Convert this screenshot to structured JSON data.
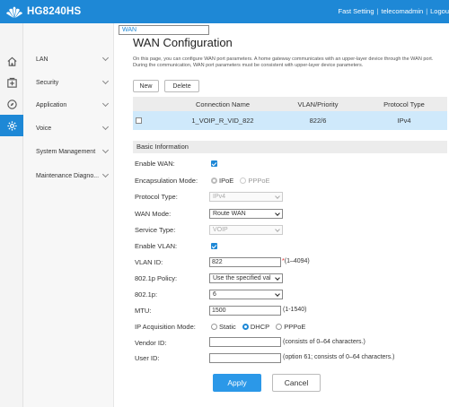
{
  "header": {
    "brand": "HG8240HS",
    "links": [
      "Fast Setting",
      "telecomadmin",
      "Logou"
    ],
    "background_color": "#1e88d6"
  },
  "icon_bar": [
    "home-icon",
    "plus-box-icon",
    "compass-icon",
    "gear-icon"
  ],
  "menu": {
    "items": [
      {
        "label": "WAN",
        "selected": true,
        "expandable": false
      },
      {
        "label": "LAN",
        "selected": false,
        "expandable": true
      },
      {
        "label": "Security",
        "selected": false,
        "expandable": true
      },
      {
        "label": "Application",
        "selected": false,
        "expandable": true
      },
      {
        "label": "Voice",
        "selected": false,
        "expandable": true
      },
      {
        "label": "System Management",
        "selected": false,
        "expandable": true
      },
      {
        "label": "Maintenance Diagno...",
        "selected": false,
        "expandable": true
      }
    ]
  },
  "page": {
    "title": "WAN Configuration",
    "description": "On this page, you can configure WAN port parameters. A home gateway communicates with an upper-layer device through the WAN port. During the communication, WAN port parameters must be consistent with upper-layer device parameters."
  },
  "toolbar": {
    "new_label": "New",
    "delete_label": "Delete"
  },
  "table": {
    "columns": [
      "Connection Name",
      "VLAN/Priority",
      "Protocol Type"
    ],
    "rows": [
      {
        "connection_name": "1_VOIP_R_VID_822",
        "vlan_priority": "822/6",
        "protocol": "IPv4",
        "selected": false
      }
    ],
    "row_highlight_color": "#cfe9fb"
  },
  "form": {
    "section_title": "Basic Information",
    "enable_wan": {
      "label": "Enable WAN:",
      "checked": true
    },
    "encapsulation": {
      "label": "Encapsulation Mode:",
      "options": [
        "IPoE",
        "PPPoE"
      ],
      "selected": "IPoE"
    },
    "protocol_type": {
      "label": "Protocol Type:",
      "value": "IPv4",
      "disabled": true
    },
    "wan_mode": {
      "label": "WAN Mode:",
      "value": "Route WAN"
    },
    "service_type": {
      "label": "Service Type:",
      "value": "VOIP",
      "disabled": true
    },
    "enable_vlan": {
      "label": "Enable VLAN:",
      "checked": true
    },
    "vlan_id": {
      "label": "VLAN ID:",
      "value": "822",
      "required_mark": "*",
      "hint": "(1–4094)"
    },
    "policy_8021p": {
      "label": "802.1p Policy:",
      "value": "Use the specified val"
    },
    "value_8021p": {
      "label": "802.1p:",
      "value": "6"
    },
    "mtu": {
      "label": "MTU:",
      "value": "1500",
      "hint": "(1-1540)"
    },
    "ip_acquisition": {
      "label": "IP Acquisition Mode:",
      "options": [
        "Static",
        "DHCP",
        "PPPoE"
      ],
      "selected": "DHCP"
    },
    "vendor_id": {
      "label": "Vendor ID:",
      "value": "",
      "hint": "(consists of 0–64 characters.)"
    },
    "user_id": {
      "label": "User ID:",
      "value": "",
      "hint": "(option 61; consists of 0–64 characters.)"
    }
  },
  "actions": {
    "apply_label": "Apply",
    "cancel_label": "Cancel",
    "apply_color": "#2b98e8"
  }
}
